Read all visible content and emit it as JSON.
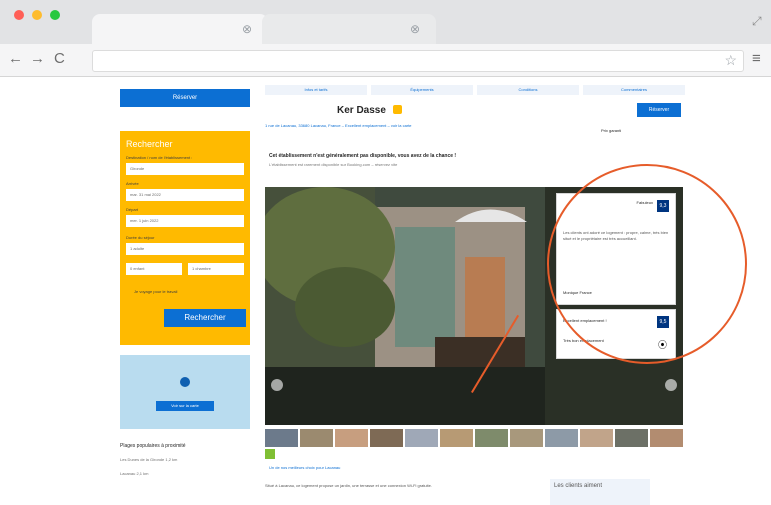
{
  "browser": {
    "title": "",
    "tabs": [
      {
        "label": ""
      },
      {
        "label": ""
      }
    ],
    "address": "",
    "icons": [
      "back-arrow-icon",
      "forward-arrow-icon",
      "reload-icon",
      "bookmark-star-icon",
      "menu-icon",
      "close-tab-icon",
      "expand-icon"
    ]
  },
  "sidebar": {
    "top_button": "Réserver",
    "search_title": "Rechercher",
    "labels": [
      "Destination / nom de l'établissement :",
      "Arrivée",
      "Départ",
      "Durée du séjour"
    ],
    "fields": [
      "Gironde",
      "mar. 31 mai 2022",
      "mer. 1 juin 2022",
      "1 adulte",
      "0 enfant",
      "1 chambre"
    ],
    "checkbox_label": "Je voyage pour le travail",
    "search_button": "Rechercher",
    "map_button": "Voir sur la carte",
    "list_title": "Plages populaires à proximité",
    "list_rows": [
      "Les Dunes de la Gironde  1,2 km",
      "Lacanau  2,1 km"
    ]
  },
  "content": {
    "subnav": [
      "Infos et tarifs",
      "Équipements",
      "Conditions",
      "Commentaires"
    ],
    "hotel_name": "Ker Dasse",
    "address": "1 rue de Lacanau, 33680 Lacanau, France – Excellent emplacement – voir la carte",
    "reserve": "Réserver",
    "price_match": "Prix garanti",
    "notice_title": "Cet établissement n'est généralement pas disponible, vous avez de la chance !",
    "notice_sub": "L'établissement est rarement disponible sur Booking.com – réservez vite",
    "review_card": {
      "title": "Fabuleux",
      "score": "9,3",
      "text": "Les clients ont adoré ce logement : propre, calme, très bien situé et le propriétaire est très accueillant.",
      "user": "Monique  France"
    },
    "review_card2": {
      "title": "Excellent emplacement !",
      "score": "9,5",
      "text": "Très bon emplacement"
    },
    "bottom_link": "Un de nos meilleurs choix pour Lacanau",
    "bottom_text": "Situé à Lacanau, ce logement propose un jardin, une terrasse et une connexion Wi-Fi gratuite.",
    "side_right_title": "Les clients aiment"
  },
  "colors": {
    "brand_blue": "#0c6fd3",
    "search_yellow": "#ffba00",
    "highlight_orange": "#e65c2a",
    "score_navy": "#003580"
  }
}
